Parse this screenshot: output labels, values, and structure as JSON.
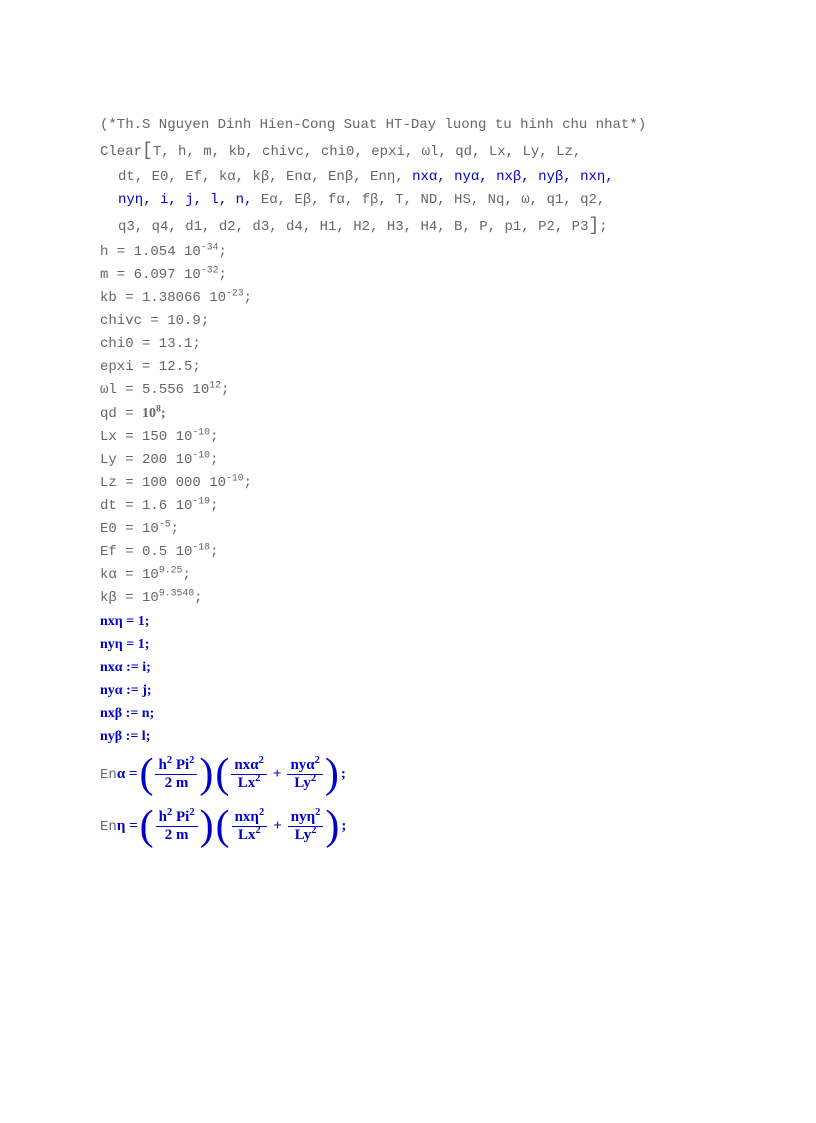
{
  "comment": "(*Th.S Nguyen Dinh Hien-Cong Suat HT-Day luong tu hinh chu nhat*)",
  "clear_head": "Clear",
  "clear_line1": "T, h, m, kb, chivc, chi0, epxi, ωl, qd, Lx, Ly, Lz,",
  "clear_line2_a": "dt, E0, Ef, kα, kβ, Enα, Enβ, Enη, ",
  "clear_line2_b": "nxα, nyα, nxβ, nyβ, nxη,",
  "clear_line3_a": "nyη, i, j, l, n,",
  "clear_line3_b": " Eα, Eβ, fα, fβ, T, ND, HS, Nq, ω, q1, q2,",
  "clear_line4": "q3, q4, d1, d2, d3, d4, H1, H2, H3, H4, B, P, p1, P2, P3",
  "assigns": {
    "h": "h = 1.054 10⁻³⁴;",
    "m": "m = 6.097 10⁻³²;",
    "kb": "kb = 1.38066 10⁻²³;",
    "chivc": "chivc = 10.9;",
    "chi0": "chi0 = 13.1;",
    "epxi": "epxi = 12.5;",
    "wl": "ωl = 5.556 10¹²;",
    "qd_a": "qd = ",
    "qd_b": " 10⁸;",
    "Lx": "Lx = 150 10⁻¹⁰;",
    "Ly": "Ly = 200 10⁻¹⁰;",
    "Lz": "Lz = 100 000 10⁻¹⁰;",
    "dt": "dt = 1.6 10⁻¹⁹;",
    "E0": "E0 = 10⁻⁵;",
    "Ef": "Ef = 0.5 10⁻¹⁸;",
    "ka": "kα = 10⁹·²⁵;",
    "kbeta": "kβ = 10⁹·³⁵⁴⁰;"
  },
  "nxn": {
    "nxeta": "nxη = 1;",
    "nyeta": "nyη = 1;",
    "nxalpha": "nxα  := i;",
    "nyalpha": "nyα  := j;",
    "nxbeta": "nxβ  := n;",
    "nybeta": "nyβ  := l;"
  },
  "en_alpha_label_a": "En",
  "en_alpha_label_b": "α = ",
  "en_eta_label_a": "En",
  "en_eta_label_b": "η = ",
  "frac_common_num": "h² Pi²",
  "frac_common_den": "2 m",
  "alpha_t1_num": "nxα²",
  "alpha_t1_den": "Lx²",
  "alpha_t2_num": "nyα²",
  "alpha_t2_den": "Ly²",
  "eta_t1_num": "nxη²",
  "eta_t1_den": "Lx²",
  "eta_t2_num": "nyη²",
  "eta_t2_den": "Ly²",
  "semi": ";"
}
